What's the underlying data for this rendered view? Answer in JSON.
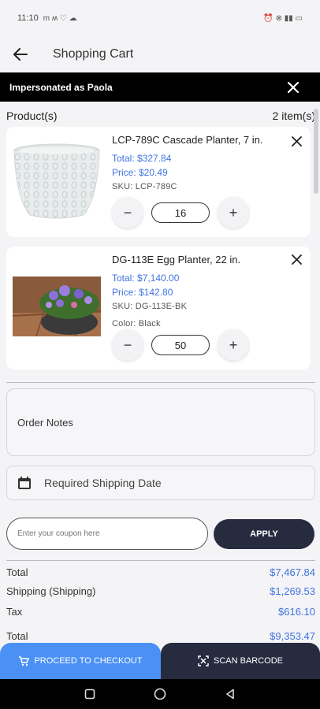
{
  "status_bar": {
    "time": "11:10",
    "left_icons": "m ʍ ♡ ☁",
    "right_icons": "⏰ ⊗ ▮▮ ▭"
  },
  "header": {
    "title": "Shopping Cart"
  },
  "impersonation": {
    "text": "Impersonated as Paola"
  },
  "products_header": {
    "label": "Product(s)",
    "count": "2 item(s)"
  },
  "products": [
    {
      "name": "LCP-789C Cascade Planter, 7 in.",
      "total": "Total: $327.84",
      "price": "Price: $20.49",
      "sku": "SKU: LCP-789C",
      "quantity": "16"
    },
    {
      "name": "DG-113E Egg Planter, 22 in.",
      "total": "Total: $7,140.00",
      "price": "Price: $142.80",
      "sku": "SKU: DG-113E-BK",
      "color": "Color: Black",
      "quantity": "50"
    }
  ],
  "order_notes": {
    "label": "Order Notes"
  },
  "shipping_date": {
    "label": "Required Shipping Date"
  },
  "coupon": {
    "placeholder": "Enter your coupon here",
    "apply_label": "APPLY"
  },
  "summary": [
    {
      "label": "Total",
      "value": "$7,467.84"
    },
    {
      "label": "Shipping (Shipping)",
      "value": "$1,269.53"
    },
    {
      "label": "Tax",
      "value": "$616.10"
    },
    {
      "label": "Total",
      "value": "$9,353.47"
    }
  ],
  "actions": {
    "checkout": "PROCEED TO CHECKOUT",
    "scan": "SCAN BARCODE"
  },
  "colors": {
    "accent": "#3f73e0",
    "checkout": "#4a90f5",
    "dark": "#262b40",
    "bar": "#000000"
  }
}
